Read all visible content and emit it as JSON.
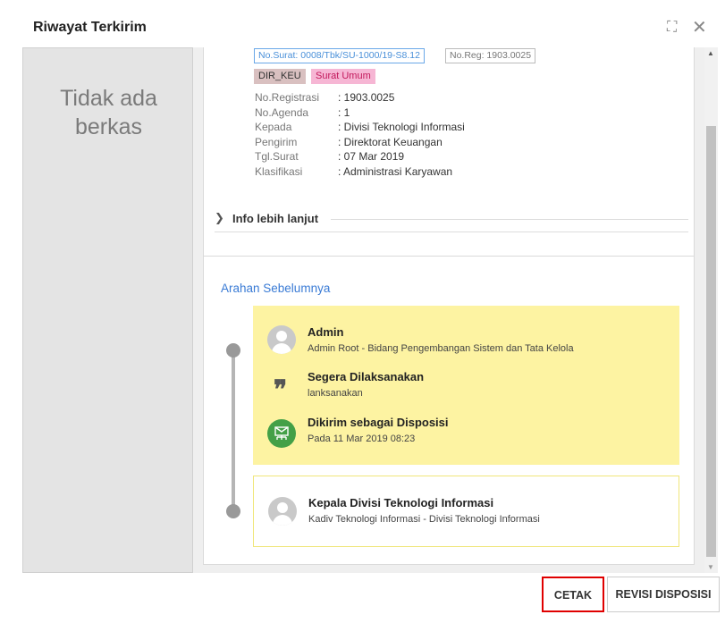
{
  "dialog": {
    "title": "Riwayat Terkirim"
  },
  "left_pane": {
    "empty_line1": "Tidak ada",
    "empty_line2": "berkas"
  },
  "letter": {
    "no_surat_tag": "No.Surat: 0008/Tbk/SU-1000/19-S8.12",
    "no_reg_tag": "No.Reg: 1903.0025",
    "chips": [
      "DIR_KEU",
      "Surat Umum"
    ],
    "fields": [
      {
        "label": "No.Registrasi",
        "value": ": 1903.0025"
      },
      {
        "label": "No.Agenda",
        "value": ": 1"
      },
      {
        "label": "Kepada",
        "value": ": Divisi Teknologi Informasi"
      },
      {
        "label": "Pengirim",
        "value": ": Direktorat Keuangan"
      },
      {
        "label": "Tgl.Surat",
        "value": ": 07 Mar 2019"
      },
      {
        "label": "Klasifikasi",
        "value": ": Administrasi Karyawan"
      }
    ],
    "more_info_label": "Info lebih lanjut"
  },
  "arahan": {
    "title": "Arahan Sebelumnya",
    "entry1": {
      "sender_name": "Admin",
      "sender_detail": "Admin Root - Bidang Pengembangan Sistem dan Tata Kelola",
      "instruction_title": "Segera Dilaksanakan",
      "instruction_note": "lanksanakan",
      "status_title": "Dikirim sebagai Disposisi",
      "status_time": "Pada 11 Mar 2019 08:23"
    },
    "entry2": {
      "recipient_name": "Kepala Divisi Teknologi Informasi",
      "recipient_detail": "Kadiv Teknologi Informasi - Divisi Teknologi Informasi"
    }
  },
  "footer": {
    "print_label": "CETAK",
    "revise_label": "REVISI DISPOSISI"
  },
  "colors": {
    "link_blue": "#3a7bd5",
    "entry_yellow": "#fdf3a2",
    "sent_green": "#43a047",
    "highlight_red": "#e00000"
  },
  "icons": {
    "expand": "expand-icon",
    "close": "close-icon",
    "avatar": "user-avatar-icon",
    "quote": "quote-icon",
    "sent": "mail-sent-icon",
    "chevron": "chevron-right-icon"
  }
}
